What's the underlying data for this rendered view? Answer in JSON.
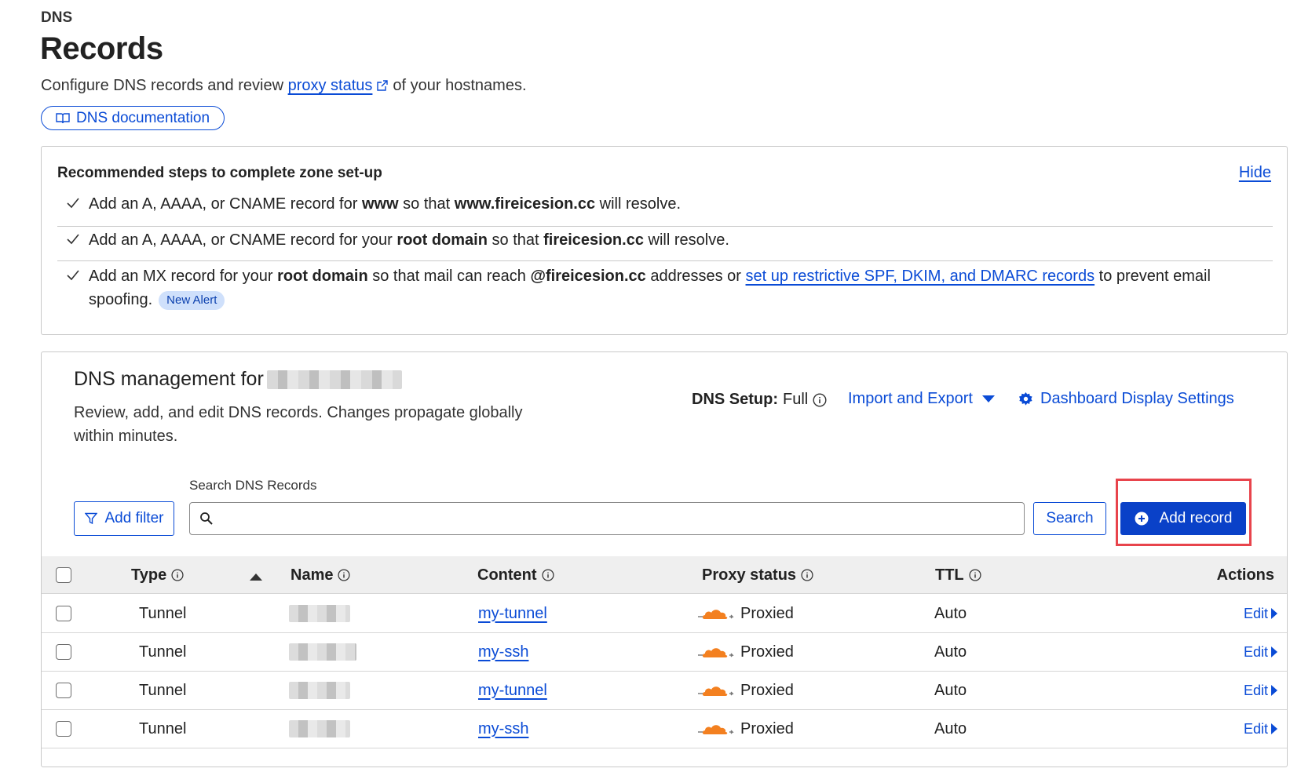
{
  "header": {
    "eyebrow": "DNS",
    "title": "Records",
    "subtitle_prefix": "Configure DNS records and review ",
    "subtitle_link": "proxy status",
    "subtitle_suffix": "of your hostnames.",
    "doc_button": "DNS documentation"
  },
  "steps": {
    "title": "Recommended steps to complete zone set-up",
    "hide_label": "Hide",
    "items": [
      {
        "p1": "Add an A, AAAA, or CNAME record for ",
        "b1": "www",
        "p2": " so that ",
        "b2": "www.fireicesion.cc",
        "p3": " will resolve."
      },
      {
        "p1": "Add an A, AAAA, or CNAME record for your ",
        "b1": "root domain",
        "p2": " so that ",
        "b2": "fireicesion.cc",
        "p3": " will resolve."
      },
      {
        "p1": "Add an MX record for your ",
        "b1": "root domain",
        "p2": " so that mail can reach ",
        "b2": "@fireicesion.cc",
        "p3": " addresses or ",
        "link": "set up restrictive SPF, DKIM, and DMARC records",
        "p4": " to prevent email spoofing.",
        "badge": "New Alert"
      }
    ]
  },
  "management": {
    "title": "DNS management for",
    "description": "Review, add, and edit DNS records. Changes propagate globally within minutes.",
    "dns_setup_label": "DNS Setup:",
    "dns_setup_value": "Full",
    "import_export": "Import and Export",
    "display_settings": "Dashboard Display Settings",
    "search_label": "Search DNS Records",
    "search_placeholder": "",
    "add_filter": "Add filter",
    "search_button": "Search",
    "add_record": "Add record"
  },
  "table": {
    "columns": {
      "type": "Type",
      "name": "Name",
      "content": "Content",
      "proxy_status": "Proxy status",
      "ttl": "TTL",
      "actions": "Actions"
    },
    "rows": [
      {
        "type": "Tunnel",
        "content": "my-tunnel",
        "proxy": "Proxied",
        "ttl": "Auto",
        "action": "Edit"
      },
      {
        "type": "Tunnel",
        "content": "my-ssh",
        "proxy": "Proxied",
        "ttl": "Auto",
        "action": "Edit"
      },
      {
        "type": "Tunnel",
        "content": "my-tunnel",
        "proxy": "Proxied",
        "ttl": "Auto",
        "action": "Edit"
      },
      {
        "type": "Tunnel",
        "content": "my-ssh",
        "proxy": "Proxied",
        "ttl": "Auto",
        "action": "Edit"
      }
    ]
  },
  "colors": {
    "link": "#0a4bd6",
    "primary_button": "#0a41c8",
    "highlight": "#e8444c",
    "cloud_orange": "#f38020",
    "badge_bg": "#cfe0fb"
  },
  "icons": {
    "external": "external-link-icon",
    "book": "book-icon",
    "check": "check-icon",
    "info": "info-icon",
    "caret": "caret-down-icon",
    "gear": "gear-icon",
    "filter": "filter-icon",
    "search": "search-icon",
    "plus": "plus-circle-icon",
    "cloud": "orange-cloud-icon"
  }
}
